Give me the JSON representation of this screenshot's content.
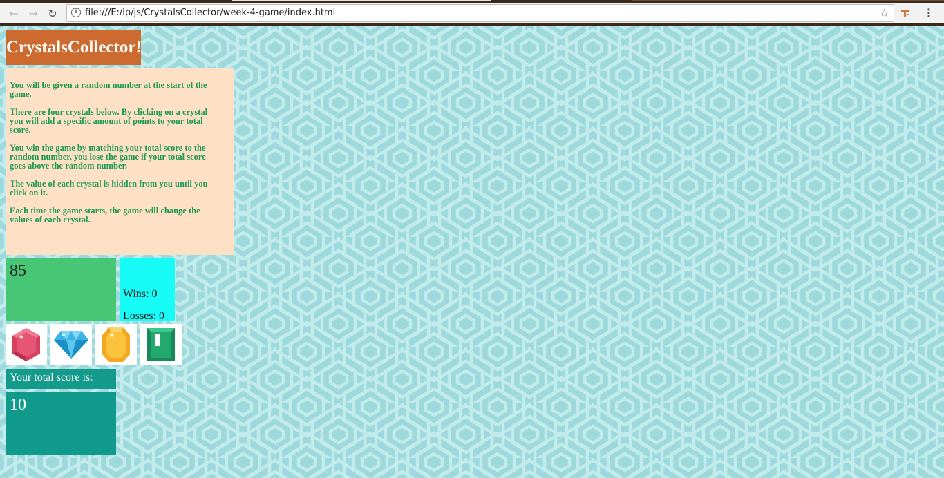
{
  "browser": {
    "url": "file:///E:/lp/js/CrystalsCollector/week-4-game/index.html",
    "back_icon": "back-arrow-icon",
    "forward_icon": "forward-arrow-icon",
    "reload_icon": "reload-icon",
    "info_icon": "info-icon",
    "bookmark_icon": "star-icon",
    "menu_icon": "kebab-menu-icon"
  },
  "game": {
    "title": "CrystalsCollector!",
    "instructions": [
      "You will be given a random number at the start of the game.",
      "There are four crystals below. By clicking on a crystal you will add a specific amount of points to your total score.",
      "You win the game by matching your total score to the random number, you lose the game if your total score goes above the random number.",
      "The value of each crystal is hidden from you until you click on it.",
      "Each time the game starts, the game will change the values of each crystal."
    ],
    "target_number": "85",
    "wins_text": "Wins: 0",
    "losses_text": "Losses: 0",
    "crystals": [
      "red-crystal-icon",
      "blue-diamond-icon",
      "yellow-crystal-icon",
      "green-crystal-icon"
    ],
    "score_label": "Your total score is:",
    "total_score": "10"
  },
  "colors": {
    "title_bg": "#cd6a2f",
    "instructions_bg": "#fde0c5",
    "instructions_text": "#1c9a53",
    "target_bg": "#47c675",
    "stats_bg": "#18fcf8",
    "score_bg": "#0f9a8b",
    "page_bg": "#9dd8dc"
  }
}
